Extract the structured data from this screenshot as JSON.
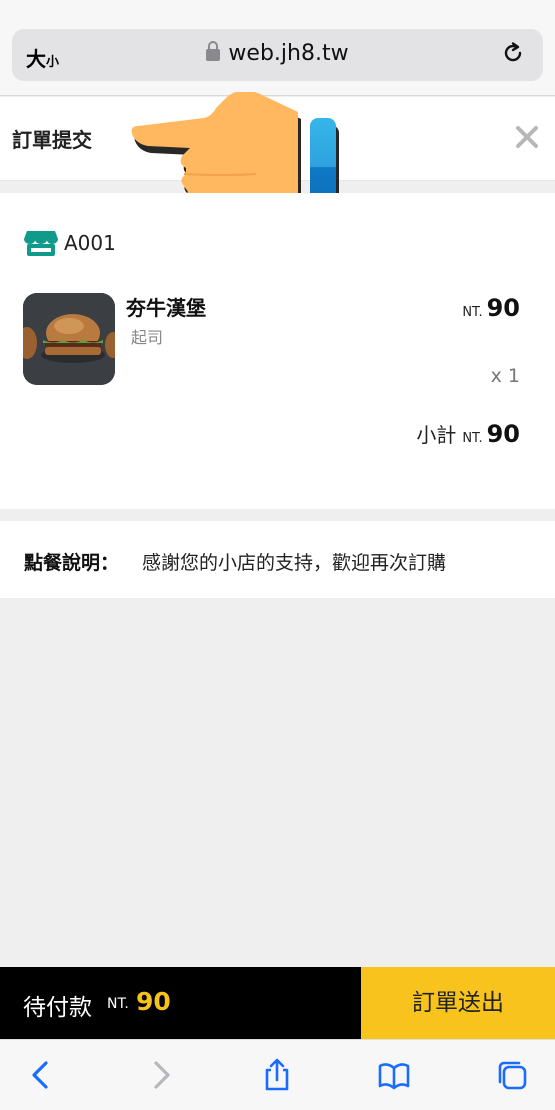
{
  "browser": {
    "text_size_label_large": "大",
    "text_size_label_small": "小",
    "url": "web.jh8.tw",
    "icons": {
      "lock": "lock-icon",
      "reload": "reload-icon"
    }
  },
  "header": {
    "title": "訂單提交",
    "close_icon": "close-icon"
  },
  "order": {
    "store_icon": "store-icon",
    "store_name": "A001",
    "item": {
      "name": "夯牛漢堡",
      "option": "起司",
      "currency": "NT.",
      "price": "90",
      "quantity": "x 1"
    },
    "subtotal_label": "小計",
    "subtotal_currency": "NT.",
    "subtotal_amount": "90"
  },
  "note": {
    "label": "點餐說明：",
    "text": "感謝您的小店的支持，歡迎再次訂購"
  },
  "footer": {
    "pay_label": "待付款",
    "pay_currency": "NT.",
    "pay_amount": "90",
    "submit_label": "訂單送出"
  },
  "toolbar": {
    "icons": [
      "back-icon",
      "forward-icon",
      "share-icon",
      "bookmarks-icon",
      "tabs-icon"
    ]
  },
  "colors": {
    "accent_yellow": "#f8c31c",
    "store_teal": "#0f9a8a",
    "browser_blue": "#1a6cff",
    "bar_black": "#000000"
  }
}
